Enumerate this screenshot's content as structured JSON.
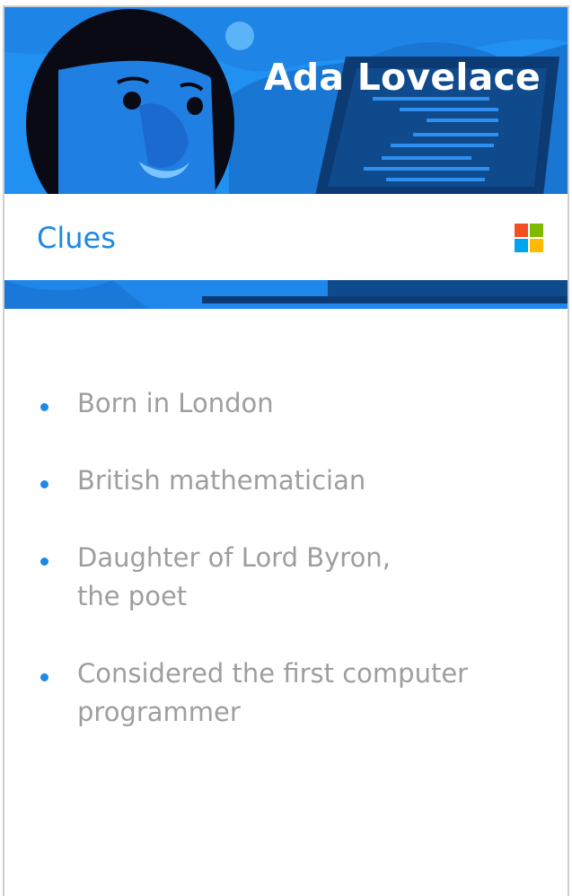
{
  "header": {
    "name": "Ada Lovelace",
    "illustration_icon": "woman-portrait-with-laptop-icon"
  },
  "section": {
    "title": "Clues",
    "logo_icon": "microsoft-logo-icon"
  },
  "clues": [
    {
      "text": "Born in London"
    },
    {
      "text": "British mathematician"
    },
    {
      "text": "Daughter of Lord Byron,\nthe poet"
    },
    {
      "text": "Considered the first computer\nprogrammer"
    }
  ],
  "colors": {
    "hero_blue": "#2190f3",
    "accent_blue": "#1e88e5",
    "clue_text": "#9e9e9e",
    "logo_red": "#f25022",
    "logo_green": "#7fba00",
    "logo_blue": "#00a4ef",
    "logo_yellow": "#ffb900"
  }
}
